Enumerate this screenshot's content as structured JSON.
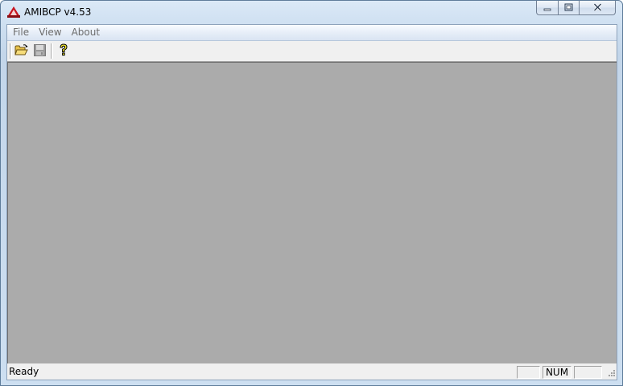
{
  "window": {
    "title": "AMIBCP v4.53",
    "app_icon": "ami-logo-icon",
    "caption_buttons": [
      "minimize-icon",
      "restore-icon",
      "close-icon"
    ]
  },
  "menubar": {
    "items": [
      {
        "label": "File"
      },
      {
        "label": "View"
      },
      {
        "label": "About"
      }
    ]
  },
  "toolbar": {
    "buttons": [
      {
        "icon": "open-folder-icon",
        "enabled": true
      },
      {
        "icon": "save-icon",
        "enabled": false
      },
      {
        "icon": "help-icon",
        "enabled": true
      }
    ]
  },
  "statusbar": {
    "text": "Ready",
    "panes": [
      "",
      "NUM",
      ""
    ]
  },
  "colors": {
    "mdi_background": "#ababab",
    "menu_text_disabled": "#6d6d6d"
  }
}
